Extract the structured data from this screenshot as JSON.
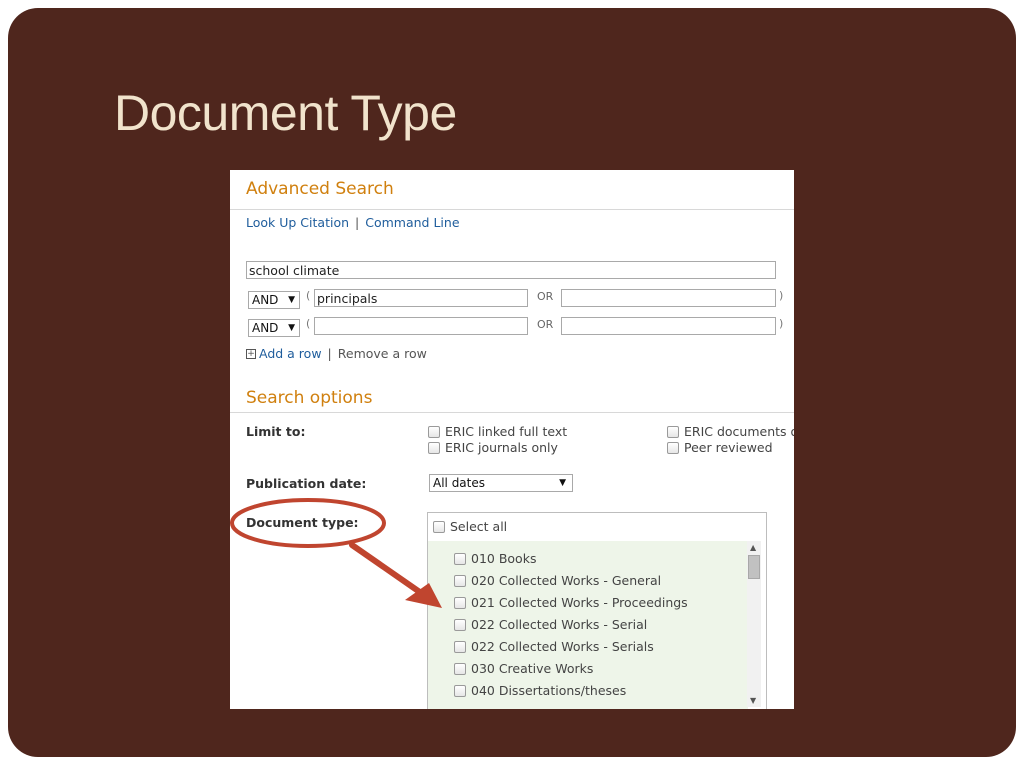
{
  "slide": {
    "title": "Document Type"
  },
  "search": {
    "heading": "Advanced Search",
    "links": {
      "lookup": "Look Up Citation",
      "separator": "|",
      "command": "Command Line"
    },
    "row1": {
      "value": "school climate"
    },
    "row2": {
      "operator": "AND",
      "left_value": "principals",
      "or_label": "OR",
      "right_value": "",
      "open_paren": "(",
      "close_paren": ")"
    },
    "row3": {
      "operator": "AND",
      "left_value": "",
      "or_label": "OR",
      "right_value": "",
      "open_paren": "(",
      "close_paren": ")"
    },
    "add_row": "Add a row",
    "remove_row": "Remove a row"
  },
  "options": {
    "heading": "Search options",
    "limit_label": "Limit to:",
    "limit_checks": [
      "ERIC linked full text",
      "ERIC journals only",
      "ERIC documents o",
      "Peer reviewed"
    ],
    "pubdate_label": "Publication date:",
    "pubdate_value": "All dates",
    "doctype_label": "Document type:",
    "select_all": "Select all",
    "doc_types": [
      "010 Books",
      "020 Collected Works - General",
      "021 Collected Works - Proceedings",
      "022 Collected Works - Serial",
      "022 Collected Works - Serials",
      "030 Creative Works",
      "040 Dissertations/theses"
    ]
  },
  "annotation": {
    "color": "#c0452f"
  }
}
